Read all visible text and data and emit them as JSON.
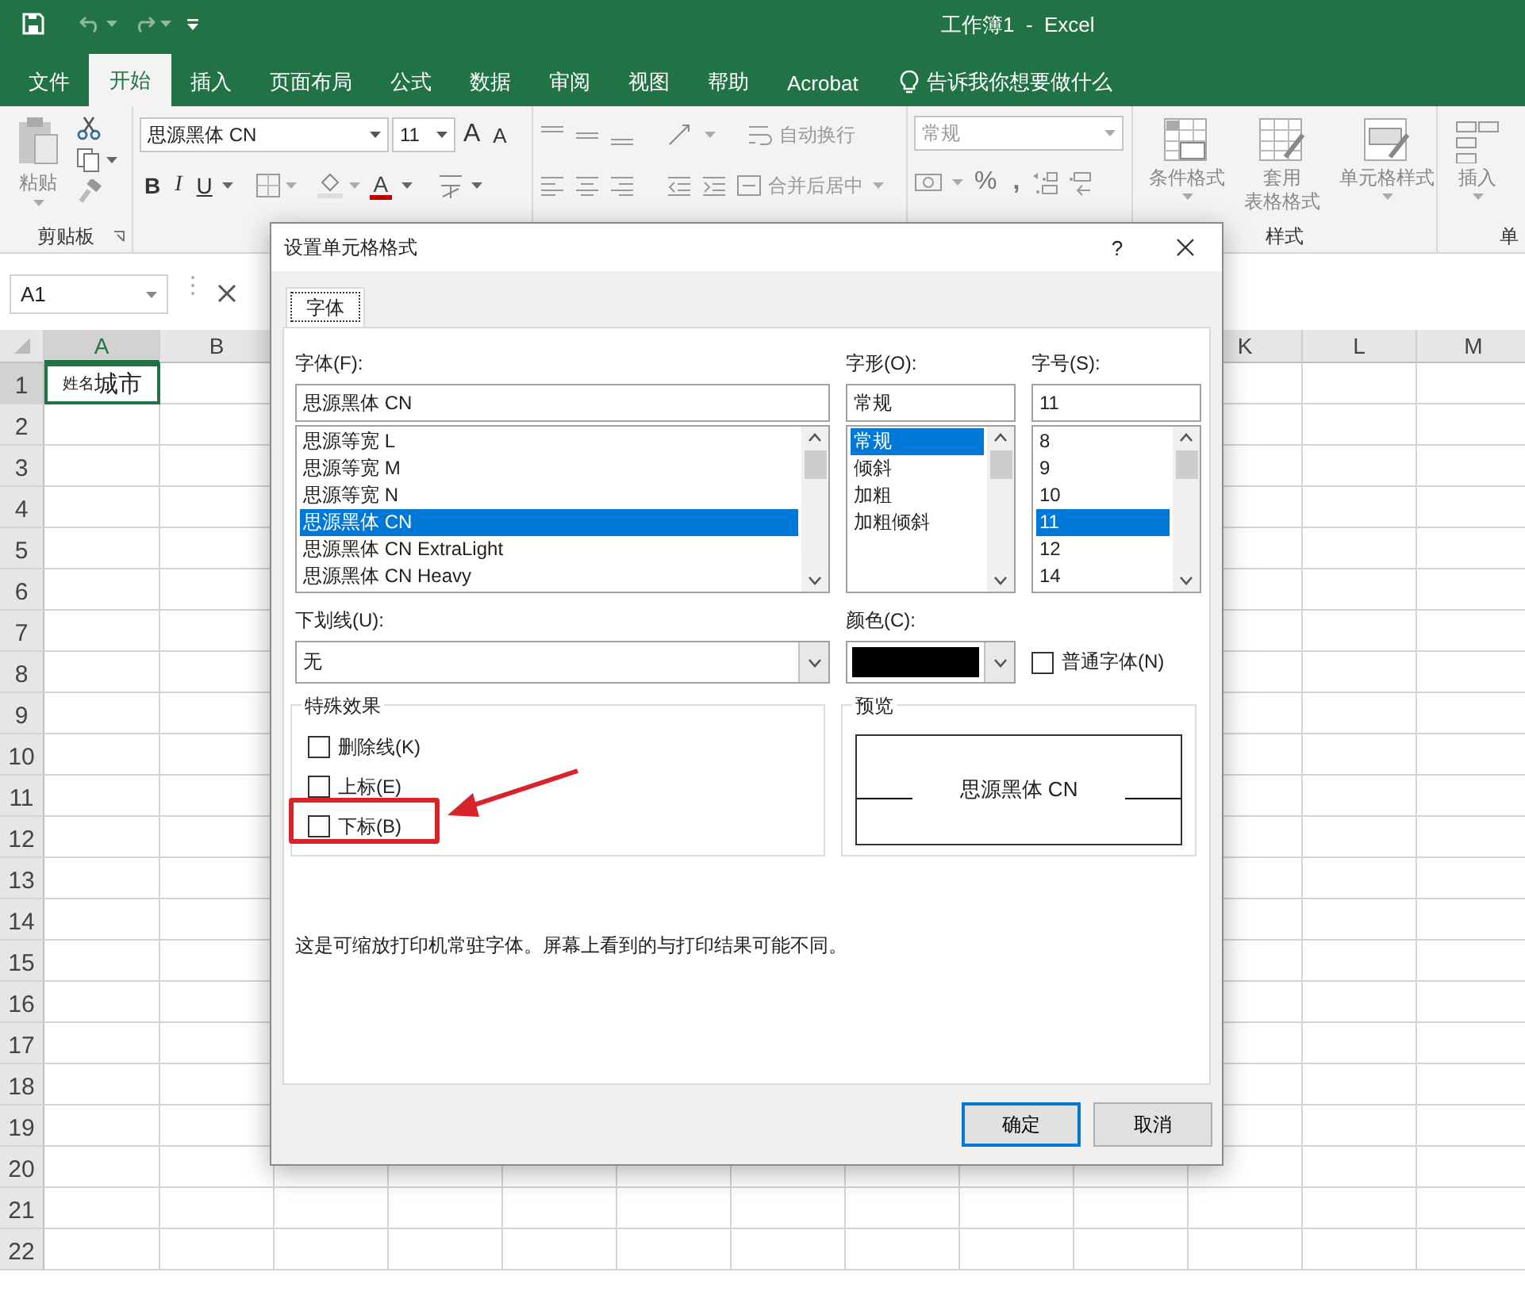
{
  "title_bar": {
    "title": "工作簿1  -  Excel"
  },
  "ribbon_tabs": [
    {
      "label": "文件",
      "selected": false
    },
    {
      "label": "开始",
      "selected": true
    },
    {
      "label": "插入",
      "selected": false
    },
    {
      "label": "页面布局",
      "selected": false
    },
    {
      "label": "公式",
      "selected": false
    },
    {
      "label": "数据",
      "selected": false
    },
    {
      "label": "审阅",
      "selected": false
    },
    {
      "label": "视图",
      "selected": false
    },
    {
      "label": "帮助",
      "selected": false
    },
    {
      "label": "Acrobat",
      "selected": false
    }
  ],
  "tell_me": {
    "placeholder": "告诉我你想要做什么"
  },
  "ribbon": {
    "paste": "粘贴",
    "clipboard_label": "剪贴板",
    "font_name": "思源黑体 CN",
    "font_size": "11",
    "grow_font": "A",
    "shrink_font": "A",
    "bold": "B",
    "italic": "I",
    "underline": "U",
    "font_color": "A",
    "wrap_text": "自动换行",
    "merge_center": "合并后居中",
    "number_format": "常规",
    "percent": "%",
    "comma": ",",
    "conditional_format": "条件格式",
    "table_format": [
      "套用",
      "表格格式"
    ],
    "cell_styles": "单元格样式",
    "styles_label": "样式",
    "insert": "插入",
    "cells_label": "单"
  },
  "formula_bar": {
    "name_box": "A1"
  },
  "sheet": {
    "left_columns": [
      "A",
      "B"
    ],
    "right_columns": [
      "K",
      "L",
      "M"
    ],
    "rows": [
      "1",
      "2",
      "3",
      "4",
      "5",
      "6",
      "7",
      "8",
      "9",
      "10",
      "11",
      "12",
      "13",
      "14",
      "15",
      "16",
      "17",
      "18",
      "19",
      "20",
      "21",
      "22"
    ],
    "a1": {
      "text": "$^{姓名}$城市",
      "selected": true
    }
  },
  "dialog": {
    "title": "设置单元格格式",
    "help": "?",
    "tabs": [
      {
        "label": "字体",
        "selected": true
      }
    ],
    "font": {
      "label": "字体(F):",
      "value": "思源黑体 CN",
      "options": [
        {
          "label": "思源等宽 L",
          "selected": false
        },
        {
          "label": "思源等宽 M",
          "selected": false
        },
        {
          "label": "思源等宽 N",
          "selected": false
        },
        {
          "label": "思源黑体 CN",
          "selected": true
        },
        {
          "label": "思源黑体 CN ExtraLight",
          "selected": false
        },
        {
          "label": "思源黑体 CN Heavy",
          "selected": false
        }
      ]
    },
    "style": {
      "label": "字形(O):",
      "value": "常规",
      "options": [
        {
          "label": "常规",
          "selected": true
        },
        {
          "label": "倾斜",
          "selected": false
        },
        {
          "label": "加粗",
          "selected": false
        },
        {
          "label": "加粗倾斜",
          "selected": false
        }
      ]
    },
    "size": {
      "label": "字号(S):",
      "value": "11",
      "options": [
        {
          "label": "8",
          "selected": false
        },
        {
          "label": "9",
          "selected": false
        },
        {
          "label": "10",
          "selected": false
        },
        {
          "label": "11",
          "selected": true
        },
        {
          "label": "12",
          "selected": false
        },
        {
          "label": "14",
          "selected": false
        }
      ]
    },
    "underline": {
      "label": "下划线(U):",
      "value": "无"
    },
    "color": {
      "label": "颜色(C):",
      "color": "#000000"
    },
    "normal_font": {
      "label": "普通字体(N)",
      "checked": false
    },
    "effects": {
      "label": "特殊效果",
      "items": [
        {
          "label": "删除线(K)",
          "checked": false
        },
        {
          "label": "上标(E)",
          "checked": false
        },
        {
          "label": "下标(B)",
          "checked": false
        }
      ]
    },
    "preview": {
      "label": "预览",
      "sample": "思源黑体 CN"
    },
    "note": "这是可缩放打印机常驻字体。屏幕上看到的与打印结果可能不同。",
    "buttons": [
      {
        "label": "确定",
        "default": true
      },
      {
        "label": "取消",
        "default": false
      }
    ]
  }
}
